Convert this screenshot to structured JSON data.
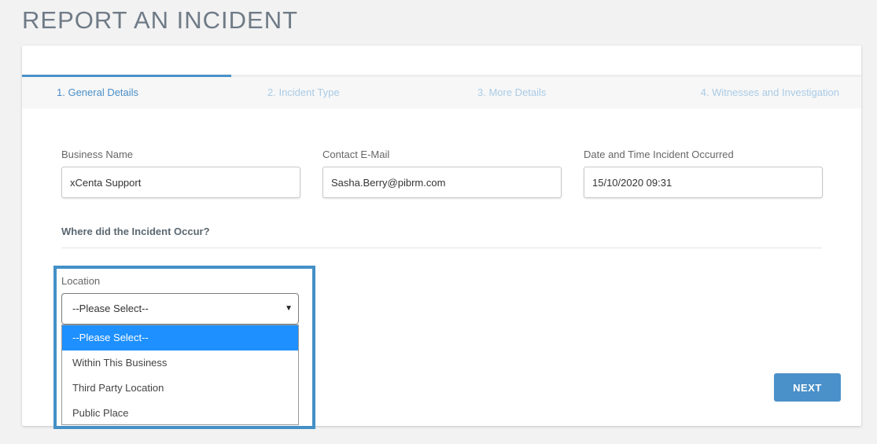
{
  "page": {
    "title": "REPORT AN INCIDENT"
  },
  "steps": [
    {
      "label": "1. General Details",
      "active": true
    },
    {
      "label": "2. Incident Type",
      "active": false
    },
    {
      "label": "3. More Details",
      "active": false
    },
    {
      "label": "4. Witnesses and Investigation",
      "active": false
    }
  ],
  "fields": {
    "business_name": {
      "label": "Business Name",
      "value": "xCenta Support"
    },
    "contact_email": {
      "label": "Contact E-Mail",
      "value": "Sasha.Berry@pibrm.com"
    },
    "incident_datetime": {
      "label": "Date and Time Incident Occurred",
      "value": "15/10/2020 09:31"
    }
  },
  "section": {
    "heading": "Where did the Incident Occur?"
  },
  "location": {
    "label": "Location",
    "selected": "--Please Select--",
    "options": [
      "--Please Select--",
      "Within This Business",
      "Third Party Location",
      "Public Place"
    ]
  },
  "actions": {
    "next_label": "NEXT"
  },
  "colors": {
    "accent": "#4a90c9",
    "highlight": "#4490c6",
    "option_selected": "#1e90ff"
  }
}
